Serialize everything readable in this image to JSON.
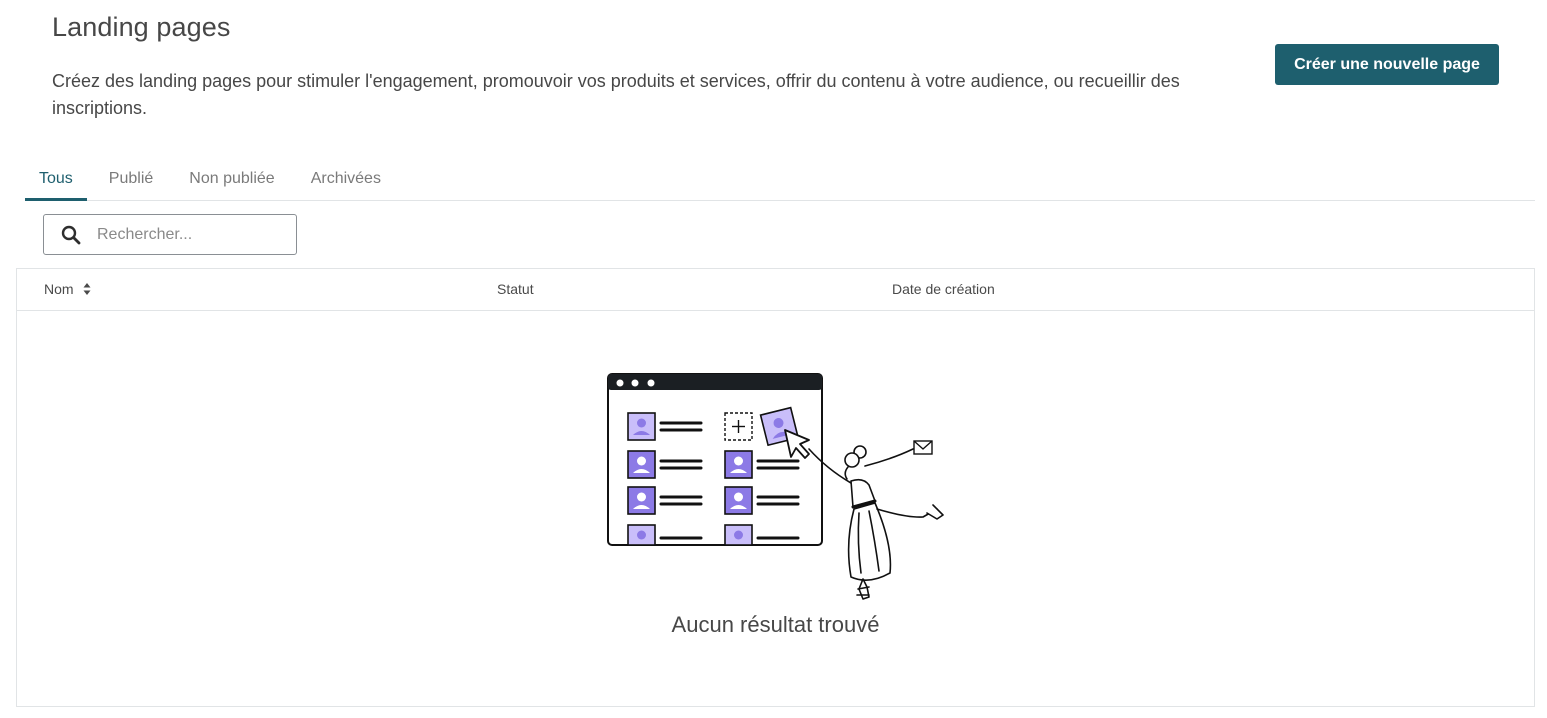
{
  "header": {
    "title": "Landing pages",
    "description": "Créez des landing pages pour stimuler l'engagement, promouvoir vos produits et services, offrir du contenu à votre audience, ou recueillir des inscriptions.",
    "create_button": "Créer une nouvelle page"
  },
  "tabs": [
    {
      "label": "Tous",
      "active": true
    },
    {
      "label": "Publié",
      "active": false
    },
    {
      "label": "Non publiée",
      "active": false
    },
    {
      "label": "Archivées",
      "active": false
    }
  ],
  "search": {
    "placeholder": "Rechercher...",
    "value": "",
    "icon": "search-icon"
  },
  "table": {
    "columns": [
      "Nom",
      "Statut",
      "Date de création"
    ],
    "sort_icon": "sort-icon",
    "rows": [],
    "empty_message": "Aucun résultat trouvé"
  },
  "colors": {
    "accent": "#1e5f6e",
    "illustration_purple": "#8c7ae6",
    "illustration_light_purple": "#c9befa"
  }
}
